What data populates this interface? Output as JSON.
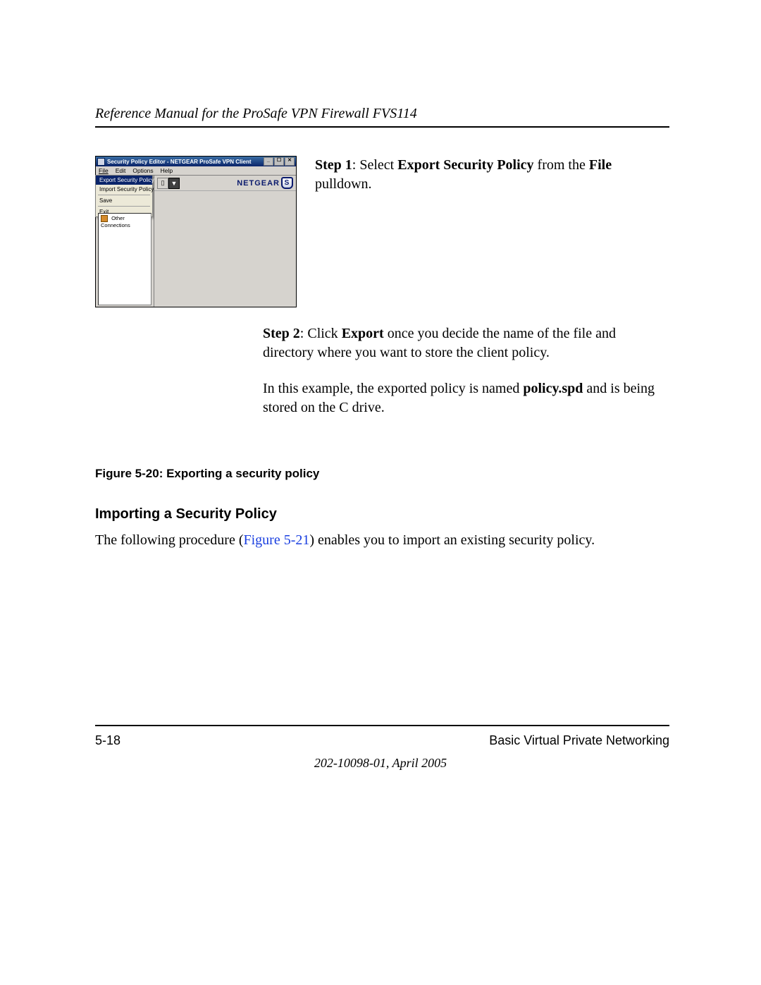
{
  "header": {
    "title": "Reference Manual for the ProSafe VPN Firewall FVS114"
  },
  "screenshot": {
    "window_title": "Security Policy Editor - NETGEAR ProSafe VPN Client",
    "menubar": [
      "File",
      "Edit",
      "Options",
      "Help"
    ],
    "file_menu": {
      "items": [
        "Export Security Policy",
        "Import Security Policy",
        "Save",
        "Exit"
      ],
      "selected_index": 0
    },
    "tree_item": "Other Connections",
    "brand": "NETGEAR",
    "brand_badge": "S"
  },
  "step1": {
    "label": "Step 1",
    "text_before_b1": ": Select ",
    "b1": "Export Security Policy",
    "text_mid": " from the ",
    "b2": "File",
    "text_after": " pulldown."
  },
  "step2": {
    "label": "Step 2",
    "text_before_b1": ": Click ",
    "b1": "Export",
    "text_after": " once you decide the name of the file and directory where you want to store the client policy."
  },
  "example_para": {
    "pre": "In this example, the exported policy is named ",
    "b1": "policy.spd",
    "post": " and is being stored on the C drive."
  },
  "figure_caption": "Figure 5-20:  Exporting a security policy",
  "section_heading": "Importing a Security Policy",
  "following_procedure": {
    "pre": "The following procedure (",
    "link": "Figure 5-21",
    "post": ") enables you to import an existing security policy."
  },
  "footer": {
    "page": "5-18",
    "chapter": "Basic Virtual Private Networking",
    "docline": "202-10098-01, April 2005"
  }
}
